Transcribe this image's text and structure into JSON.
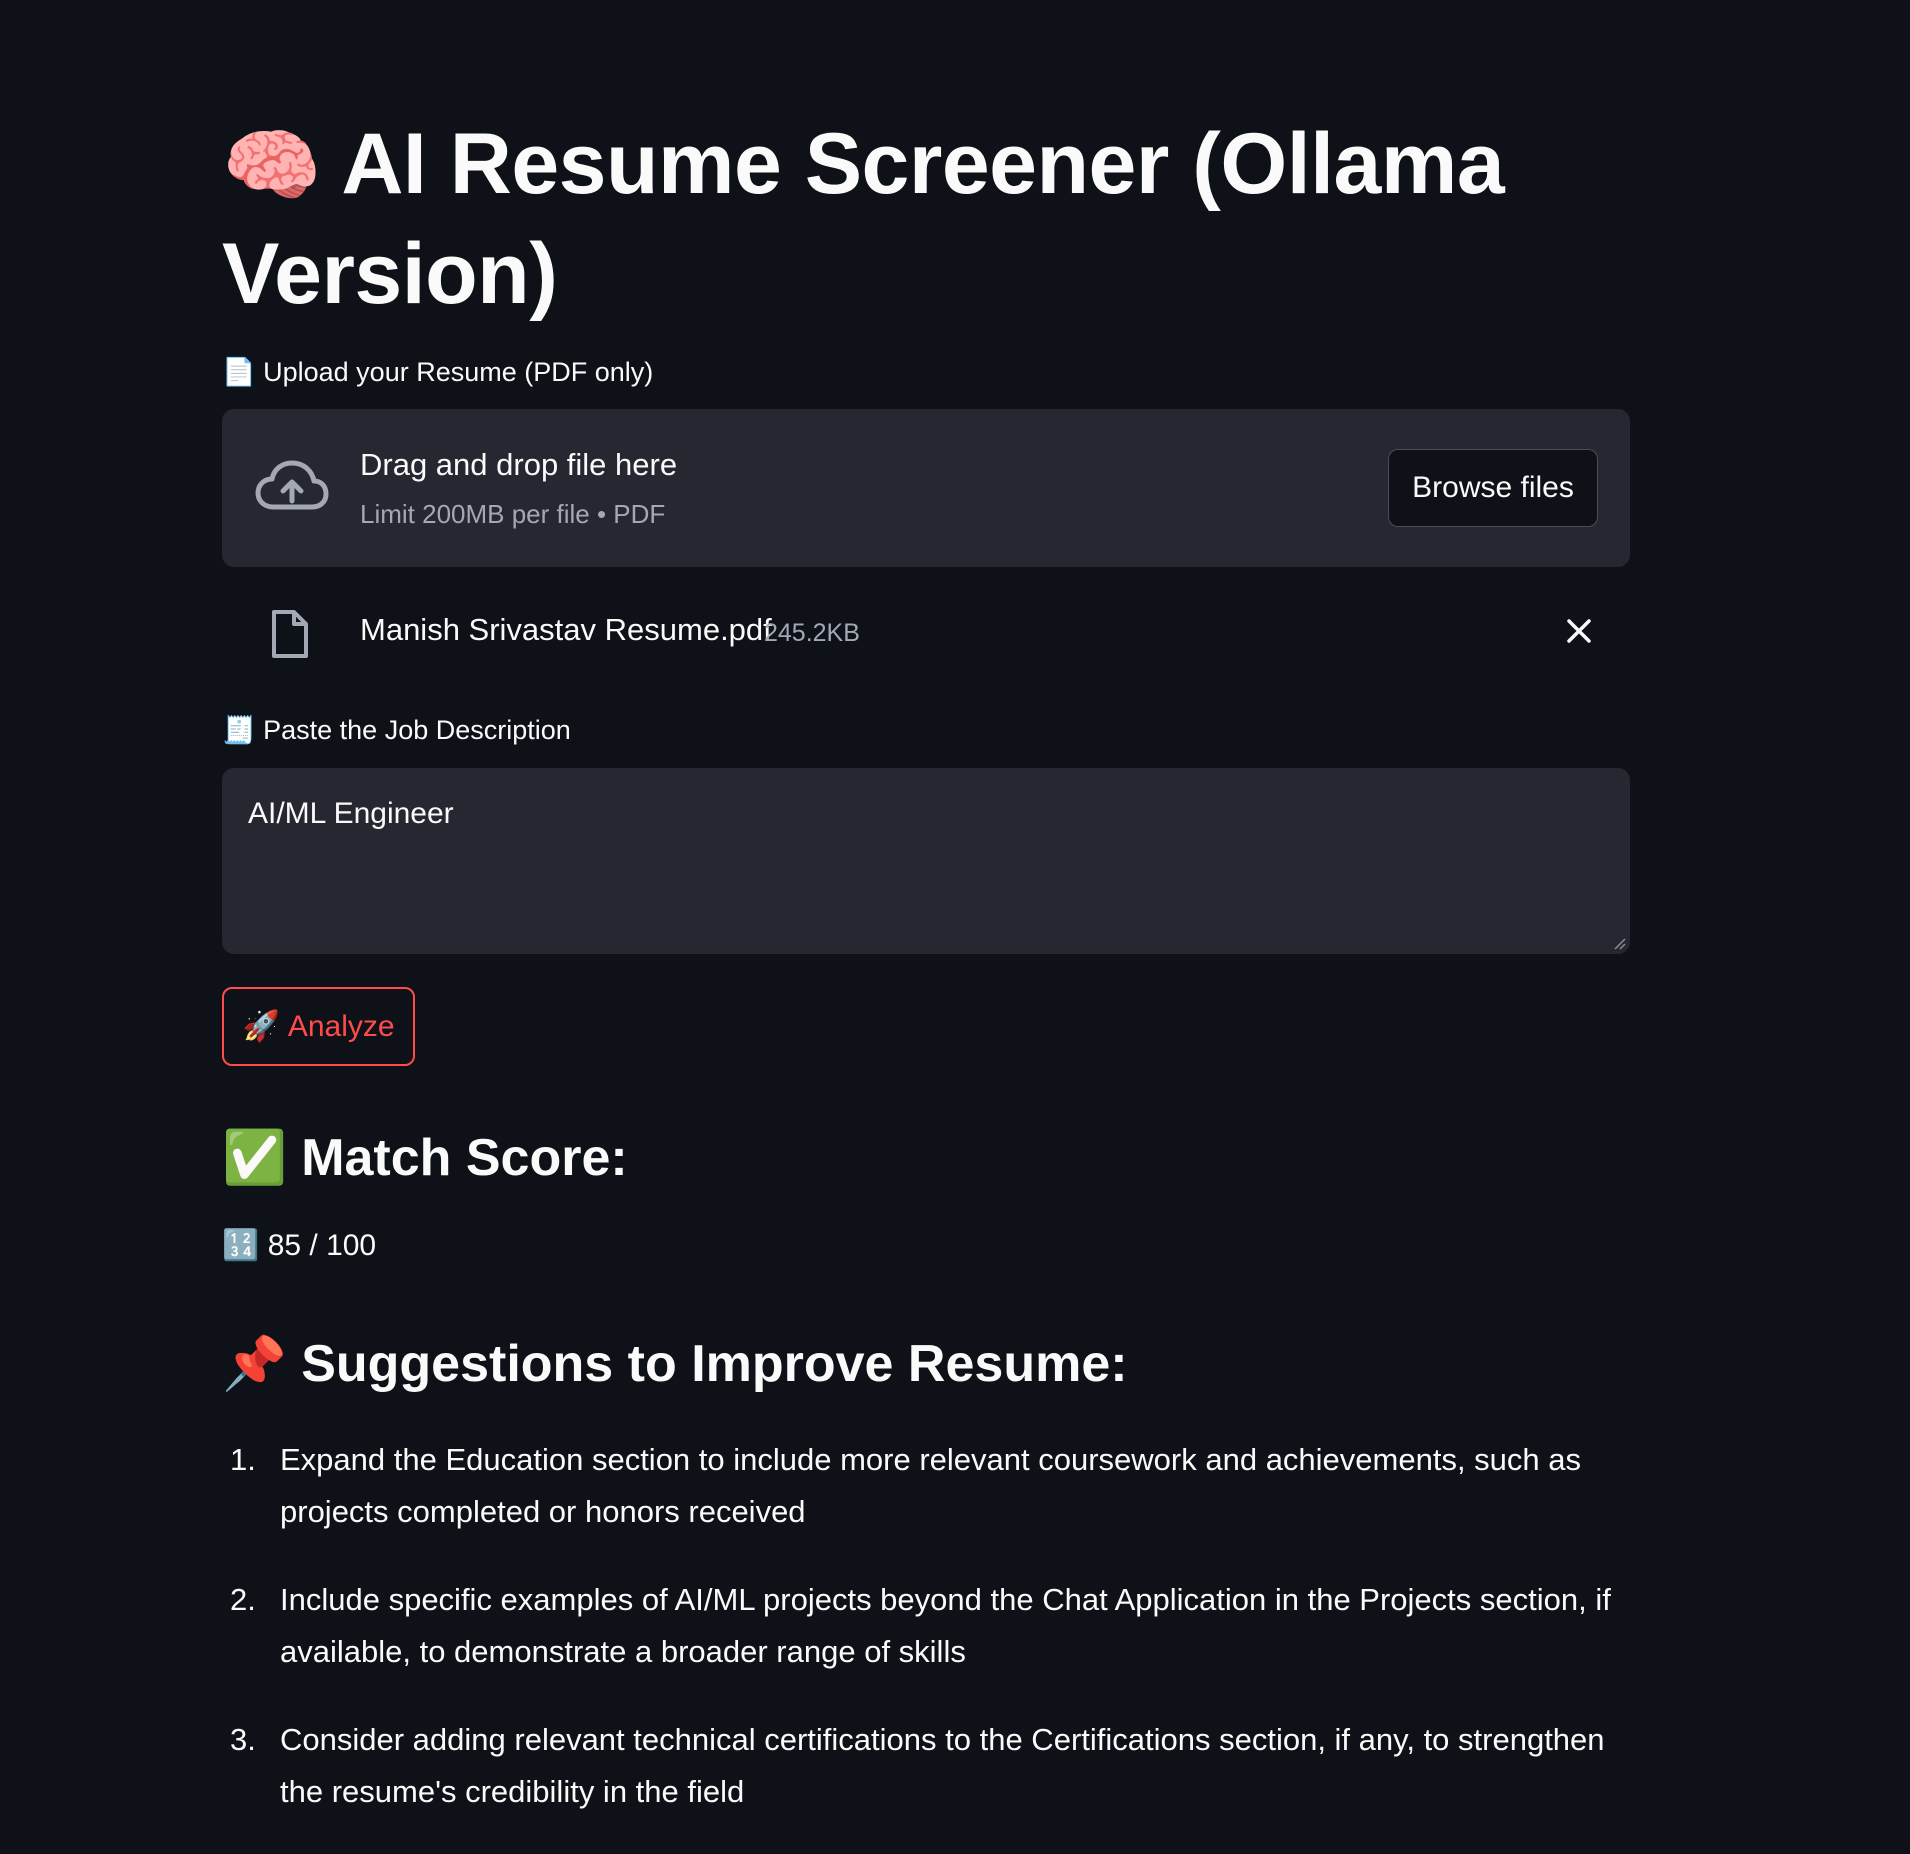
{
  "title": {
    "emoji": "🧠",
    "text": "AI Resume Screener (Ollama Version)"
  },
  "upload": {
    "label": "📄 Upload your Resume (PDF only)",
    "drag_text": "Drag and drop file here",
    "limit_text": "Limit 200MB per file • PDF",
    "browse_label": "Browse files",
    "icons": {
      "cloud": "cloud-upload-icon",
      "file": "file-icon",
      "remove": "close-icon"
    }
  },
  "uploaded_file": {
    "name": "Manish Srivastav Resume.pdf",
    "size": "245.2KB"
  },
  "job_description": {
    "label": "🧾 Paste the Job Description",
    "value": "AI/ML Engineer"
  },
  "analyze": {
    "emoji": "🚀",
    "label": "Analyze"
  },
  "match": {
    "heading": "✅ Match Score:",
    "score_text": "🔢 85 / 100"
  },
  "suggestions": {
    "heading": "📌 Suggestions to Improve Resume:",
    "items": [
      {
        "num": "1.",
        "text": "Expand the Education section to include more relevant coursework and achievements, such as projects completed or honors received"
      },
      {
        "num": "2.",
        "text": "Include specific examples of AI/ML projects beyond the Chat Application in the Projects section, if available, to demonstrate a broader range of skills"
      },
      {
        "num": "3.",
        "text": "Consider adding relevant technical certifications to the Certifications section, if any, to strengthen the resume's credibility in the field"
      }
    ]
  },
  "colors": {
    "background": "#0e1117",
    "surface": "#262730",
    "accent": "#ff4b4b",
    "text": "#fafafa",
    "muted": "#a3a8b4"
  }
}
